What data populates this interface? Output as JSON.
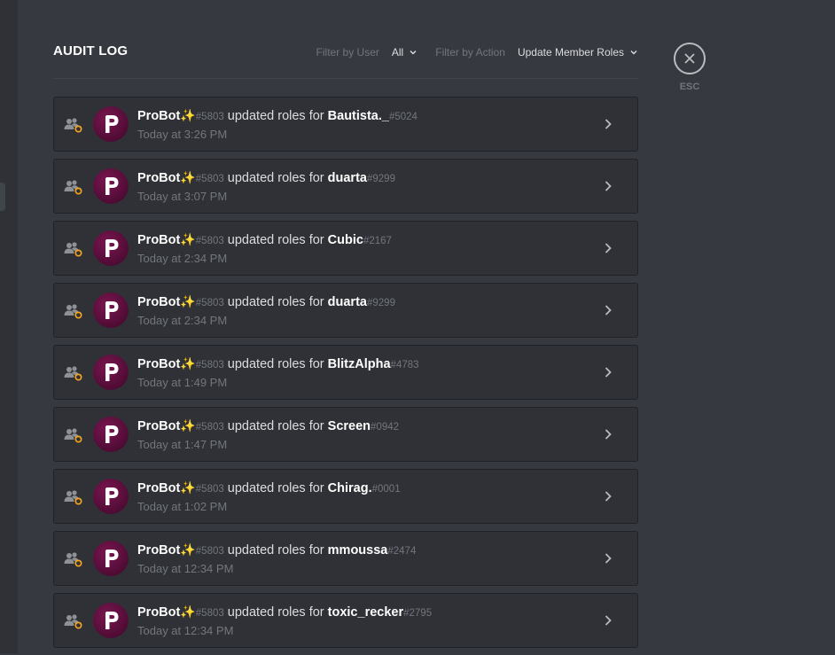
{
  "header": {
    "title": "AUDIT LOG",
    "filter_user_label": "Filter by User",
    "filter_user_value": "All",
    "filter_action_label": "Filter by Action",
    "filter_action_value": "Update Member Roles"
  },
  "close": {
    "label": "ESC"
  },
  "entries": [
    {
      "actor": "ProBot",
      "emoji": "✨",
      "actor_disc": "#5803",
      "action": "updated roles for",
      "target": "Bautista._",
      "target_disc": "#5024",
      "time": "Today at 3:26 PM"
    },
    {
      "actor": "ProBot",
      "emoji": "✨",
      "actor_disc": "#5803",
      "action": "updated roles for",
      "target": "duarta",
      "target_disc": "#9299",
      "time": "Today at 3:07 PM"
    },
    {
      "actor": "ProBot",
      "emoji": "✨",
      "actor_disc": "#5803",
      "action": "updated roles for",
      "target": "Cubic",
      "target_disc": "#2167",
      "time": "Today at 2:34 PM"
    },
    {
      "actor": "ProBot",
      "emoji": "✨",
      "actor_disc": "#5803",
      "action": "updated roles for",
      "target": "duarta",
      "target_disc": "#9299",
      "time": "Today at 2:34 PM"
    },
    {
      "actor": "ProBot",
      "emoji": "✨",
      "actor_disc": "#5803",
      "action": "updated roles for",
      "target": "BlitzAlpha",
      "target_disc": "#4783",
      "time": "Today at 1:49 PM"
    },
    {
      "actor": "ProBot",
      "emoji": "✨",
      "actor_disc": "#5803",
      "action": "updated roles for",
      "target": "Screen",
      "target_disc": "#0942",
      "time": "Today at 1:47 PM"
    },
    {
      "actor": "ProBot",
      "emoji": "✨",
      "actor_disc": "#5803",
      "action": "updated roles for",
      "target": "Chirag.",
      "target_disc": "#0001",
      "time": "Today at 1:02 PM"
    },
    {
      "actor": "ProBot",
      "emoji": "✨",
      "actor_disc": "#5803",
      "action": "updated roles for",
      "target": "mmoussa",
      "target_disc": "#2474",
      "time": "Today at 12:34 PM"
    },
    {
      "actor": "ProBot",
      "emoji": "✨",
      "actor_disc": "#5803",
      "action": "updated roles for",
      "target": "toxic_recker",
      "target_disc": "#2795",
      "time": "Today at 12:34 PM"
    }
  ],
  "icons": {
    "row_icon": "member-role-update-icon",
    "avatar": "probot-avatar",
    "arrow": "chevron-right-icon",
    "close": "close-icon"
  },
  "colors": {
    "background": "#36393f",
    "row_background": "#2f3136",
    "avatar_background": "#5a0e3d",
    "role_icon_accent": "#faa61a"
  }
}
